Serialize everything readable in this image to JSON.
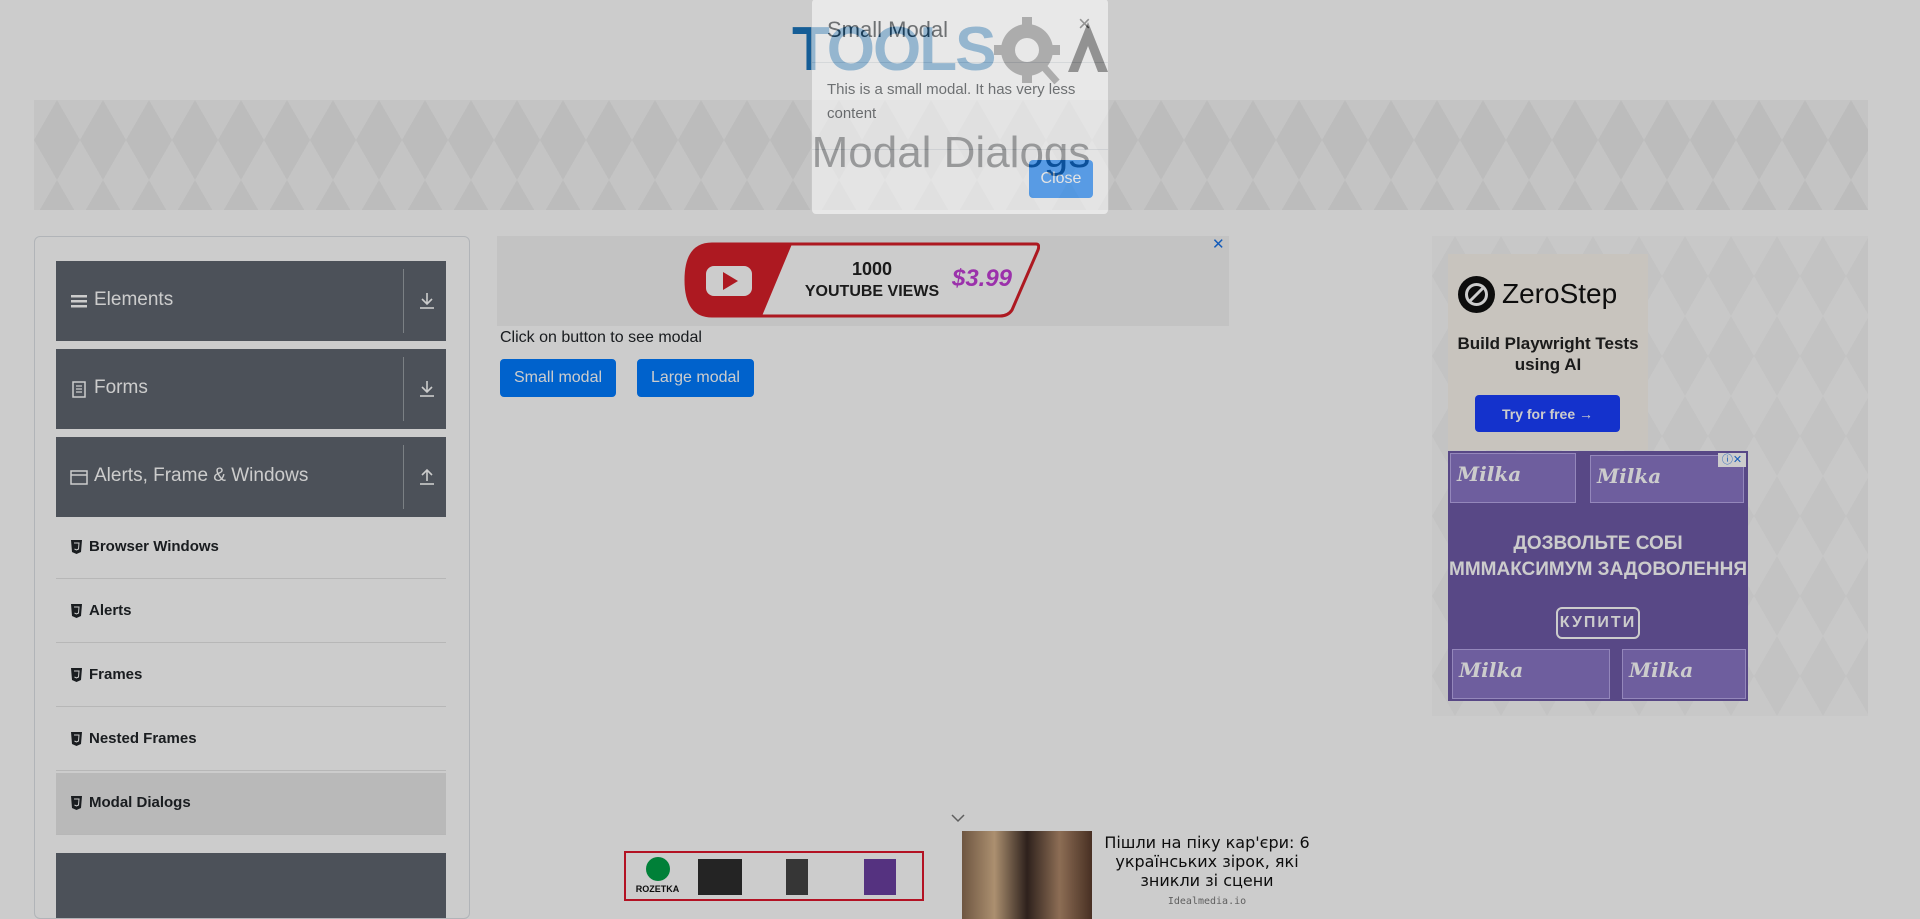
{
  "header": {
    "logo_text": "TOOLSQA",
    "page_title": "Modal Dialogs"
  },
  "sidebar": {
    "groups": [
      {
        "label": "Elements",
        "icon": "hamburger-icon",
        "arrow": "download-icon"
      },
      {
        "label": "Forms",
        "icon": "document-icon",
        "arrow": "download-icon"
      },
      {
        "label": "Alerts, Frame & Windows",
        "icon": "window-icon",
        "arrow": "upload-icon"
      }
    ],
    "items": [
      {
        "label": "Browser Windows"
      },
      {
        "label": "Alerts"
      },
      {
        "label": "Frames"
      },
      {
        "label": "Nested Frames"
      },
      {
        "label": "Modal Dialogs",
        "active": true
      }
    ]
  },
  "main": {
    "intro": "Click on button to see modal",
    "small_modal_label": "Small modal",
    "large_modal_label": "Large modal"
  },
  "ads": {
    "youtube": {
      "line1": "1000",
      "line2": "YOUTUBE VIEWS",
      "price": "$3.99",
      "close": "✕"
    },
    "zerostep": {
      "name": "ZeroStep",
      "tagline": "Build Playwright Tests using AI",
      "button": "Try for free →"
    },
    "milka": {
      "brand": "Milka",
      "headline_1": "ДОЗВОЛЬТЕ СОБІ",
      "headline_2": "МММАКСИМУМ ЗАДОВОЛЕННЯ",
      "button": "КУПИТИ"
    },
    "bottom": {
      "rozetka": "ROZETKA",
      "headline": "Пішли на піку кар'єри: 6 українських зірок, які зникли зі сцени",
      "source": "Idealmedia.io"
    }
  },
  "modal": {
    "title": "Small Modal",
    "close_x": "×",
    "body": "This is a small modal. It has very less content",
    "close_button": "Close"
  },
  "colors": {
    "sidebar_group_bg": "#5f6670",
    "primary_button": "#007bff",
    "zerostep_button": "#1a3fff",
    "milka_purple": "#6e5aa8",
    "logo_blue": "#1b75bc"
  }
}
